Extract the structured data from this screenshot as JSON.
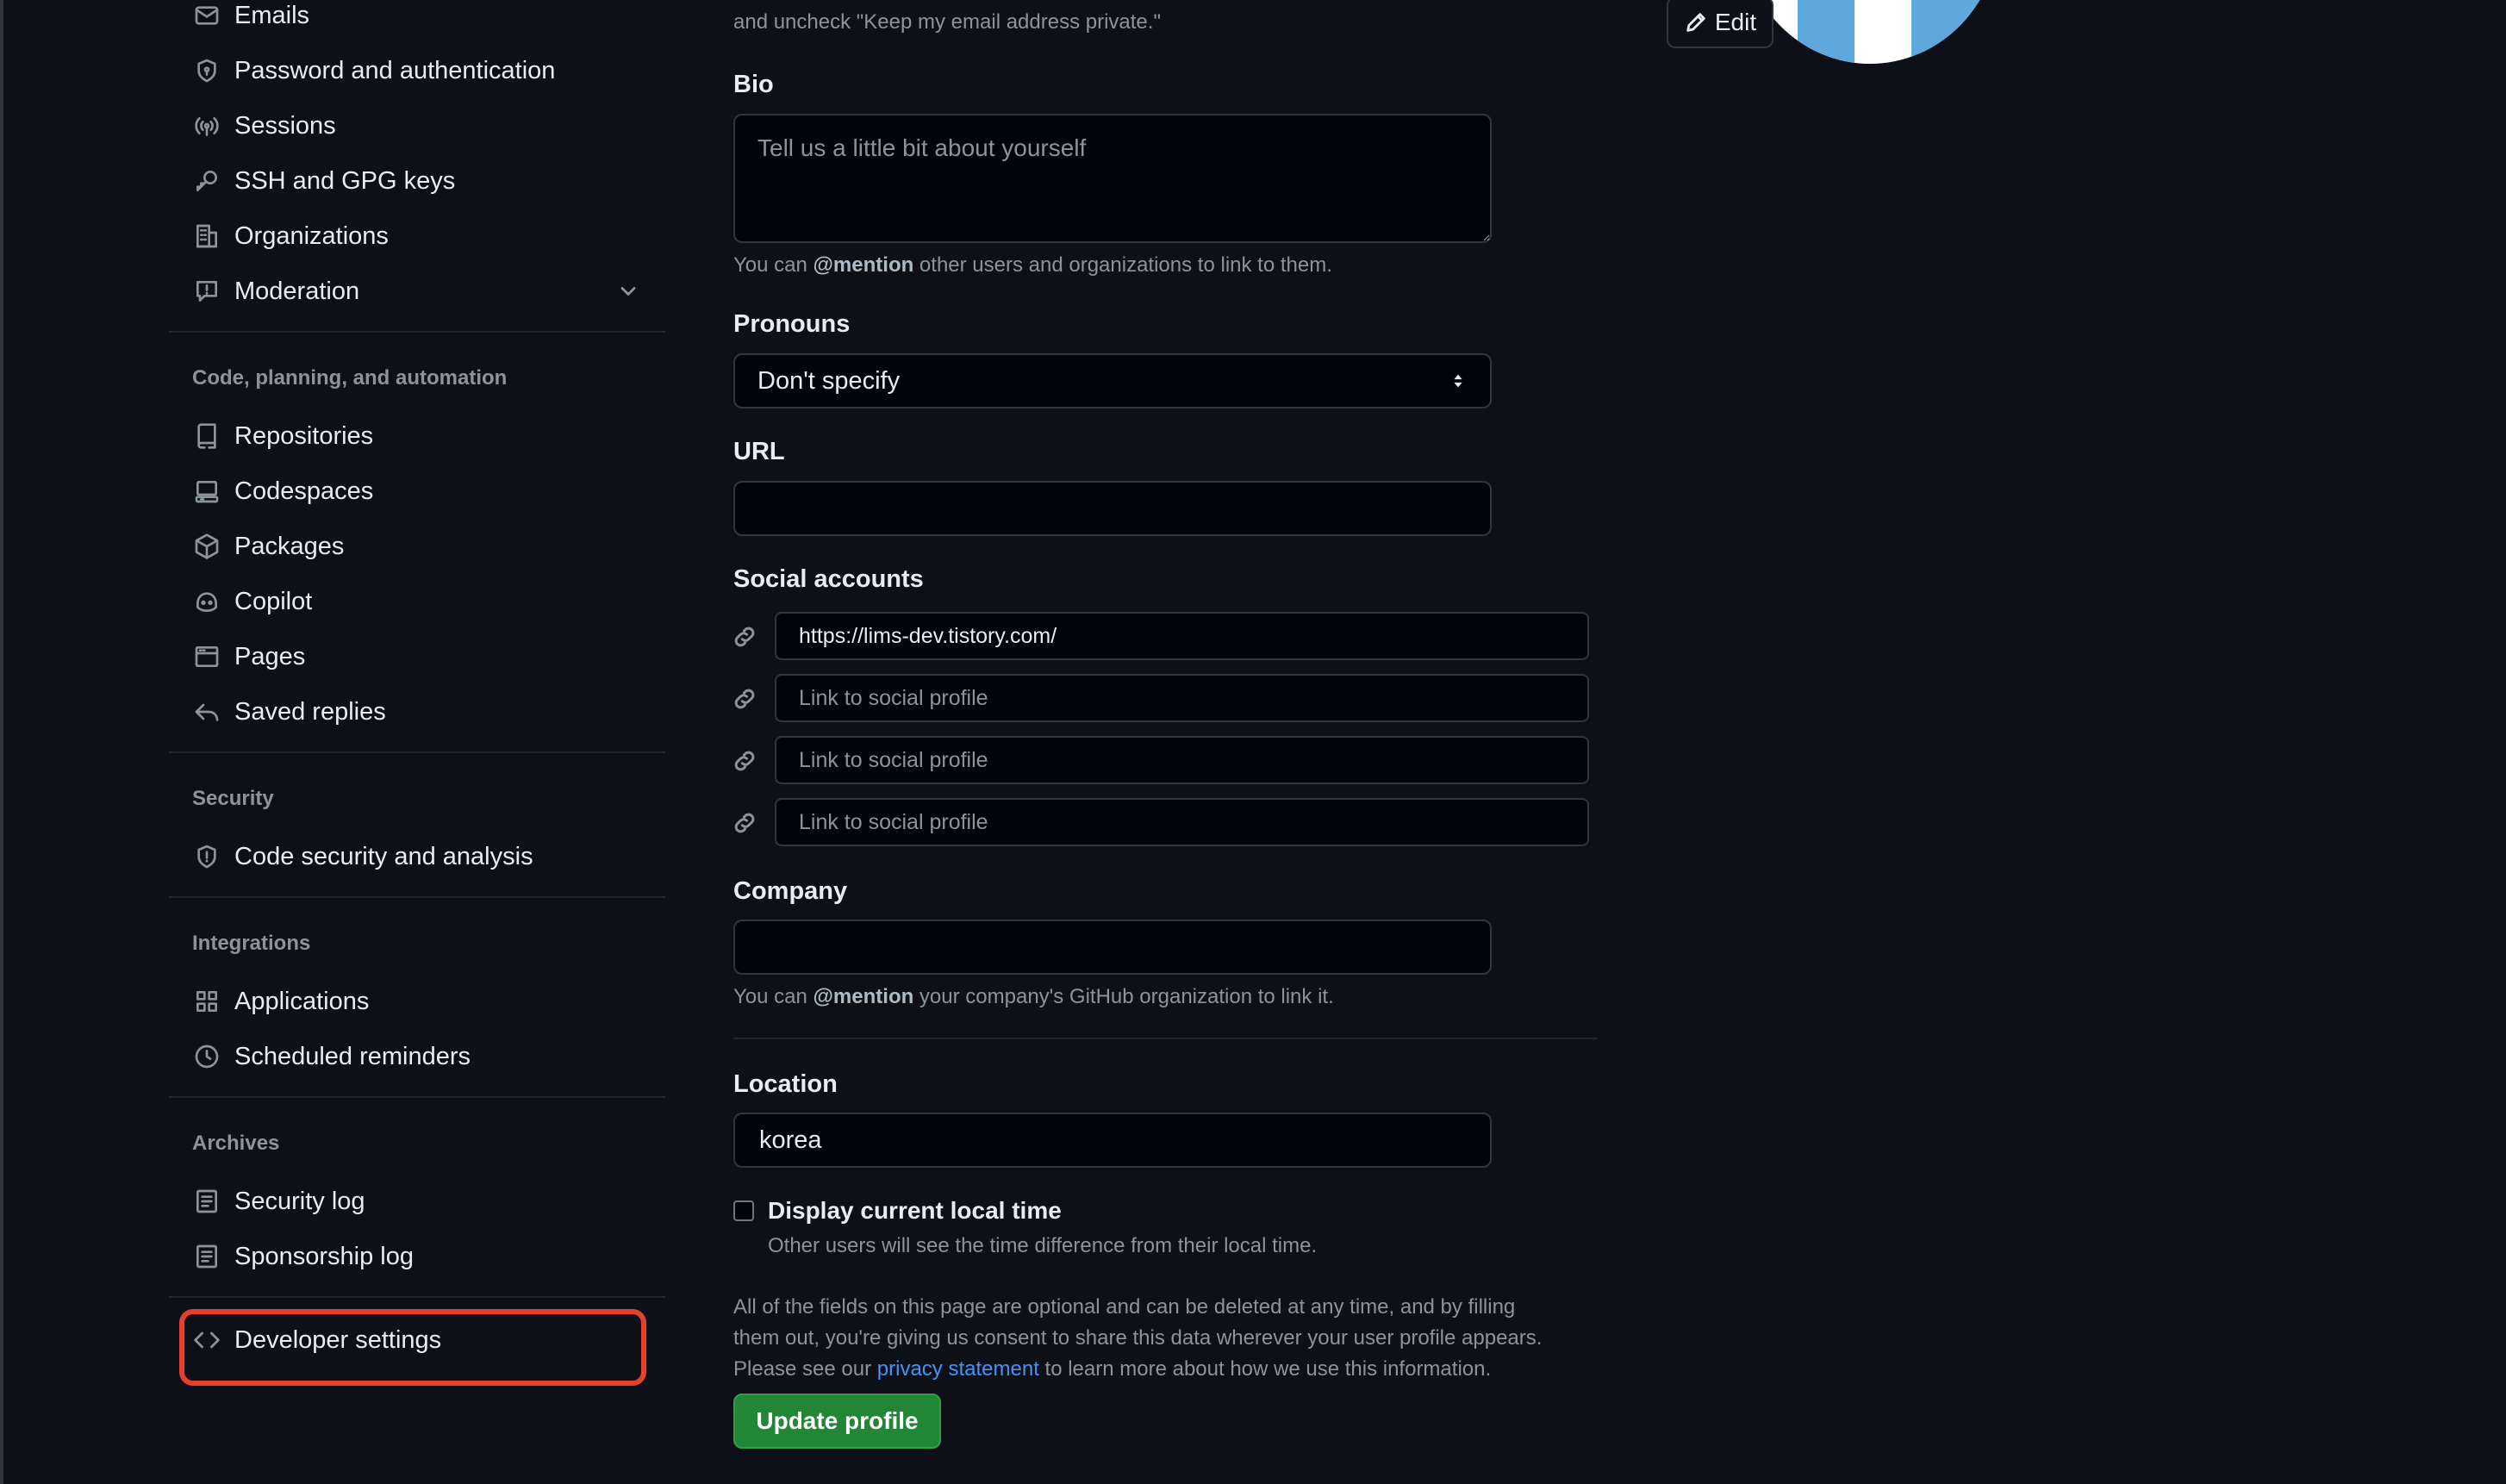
{
  "sidebar": {
    "items_top": [
      {
        "label": "Emails",
        "icon": "mail-icon"
      },
      {
        "label": "Password and authentication",
        "icon": "shield-lock-icon"
      },
      {
        "label": "Sessions",
        "icon": "broadcast-icon"
      },
      {
        "label": "SSH and GPG keys",
        "icon": "key-icon"
      },
      {
        "label": "Organizations",
        "icon": "organization-icon"
      },
      {
        "label": "Moderation",
        "icon": "report-icon"
      }
    ],
    "section_code": "Code, planning, and automation",
    "items_code": [
      {
        "label": "Repositories",
        "icon": "repo-icon"
      },
      {
        "label": "Codespaces",
        "icon": "codespaces-icon"
      },
      {
        "label": "Packages",
        "icon": "package-icon"
      },
      {
        "label": "Copilot",
        "icon": "copilot-icon"
      },
      {
        "label": "Pages",
        "icon": "browser-icon"
      },
      {
        "label": "Saved replies",
        "icon": "reply-icon"
      }
    ],
    "section_security": "Security",
    "items_security": [
      {
        "label": "Code security and analysis",
        "icon": "shield-icon"
      }
    ],
    "section_integrations": "Integrations",
    "items_integrations": [
      {
        "label": "Applications",
        "icon": "apps-icon"
      },
      {
        "label": "Scheduled reminders",
        "icon": "clock-icon"
      }
    ],
    "section_archives": "Archives",
    "items_archives": [
      {
        "label": "Security log",
        "icon": "log-icon"
      },
      {
        "label": "Sponsorship log",
        "icon": "log-icon"
      }
    ],
    "developer_settings": {
      "label": "Developer settings",
      "icon": "code-icon"
    }
  },
  "main": {
    "email_note_tail": "and uncheck \"Keep my email address private.\"",
    "bio": {
      "label": "Bio",
      "placeholder": "Tell us a little bit about yourself",
      "value": ""
    },
    "bio_note": {
      "pre": "You can ",
      "mention": "@mention",
      "post": " other users and organizations to link to them."
    },
    "pronouns": {
      "label": "Pronouns",
      "selected": "Don't specify"
    },
    "url": {
      "label": "URL",
      "value": ""
    },
    "social": {
      "label": "Social accounts",
      "values": [
        "https://lims-dev.tistory.com/",
        "",
        "",
        ""
      ],
      "placeholder": "Link to social profile"
    },
    "company": {
      "label": "Company",
      "value": ""
    },
    "company_note": {
      "pre": "You can ",
      "mention": "@mention",
      "post": " your company's GitHub organization to link it."
    },
    "location": {
      "label": "Location",
      "value": "korea"
    },
    "local_time": {
      "label": "Display current local time",
      "note": "Other users will see the time difference from their local time.",
      "checked": false
    },
    "consent": {
      "line1": "All of the fields on this page are optional and can be deleted at any time, and by filling",
      "line2": "them out, you're giving us consent to share this data wherever your user profile appears.",
      "line3_pre": "Please see our ",
      "line3_link": "privacy statement",
      "line3_post": " to learn more about how we use this information."
    },
    "update_button": "Update profile"
  },
  "avatar": {
    "edit_label": "Edit"
  },
  "colors": {
    "background": "#0d1117",
    "accent_green": "#238636",
    "link_blue": "#4493f8",
    "highlight_red": "#e8402f"
  }
}
